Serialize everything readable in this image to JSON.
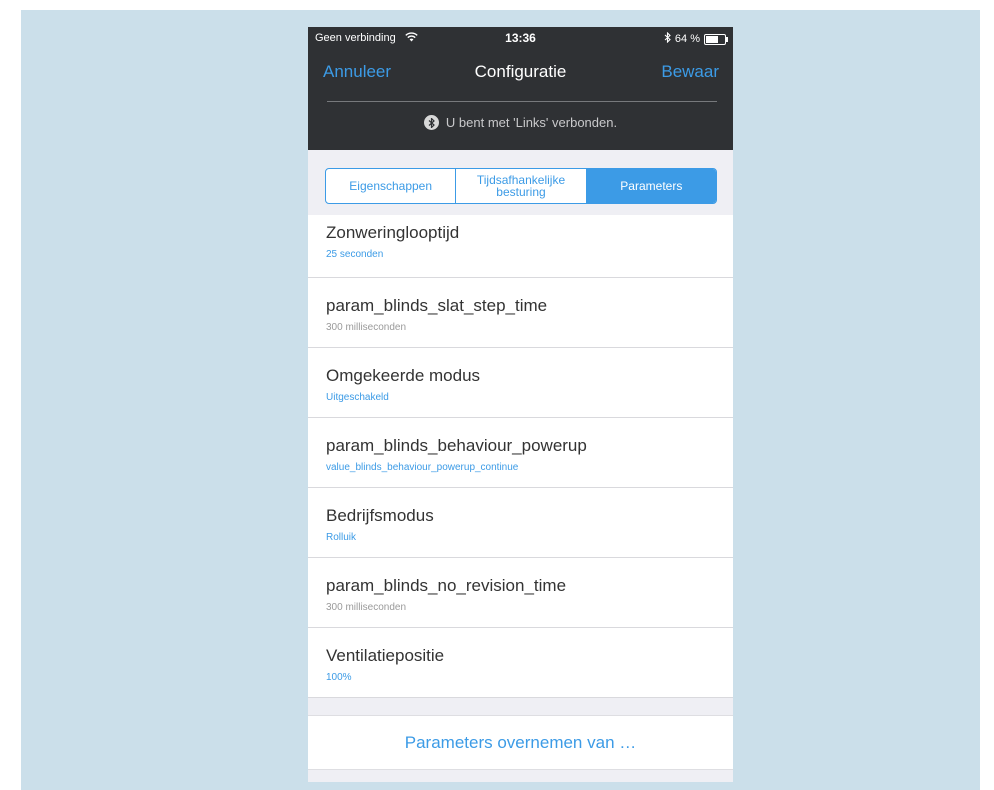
{
  "status_bar": {
    "carrier": "Geen verbinding",
    "time": "13:36",
    "battery": "64 %",
    "battery_level": 0.64
  },
  "navbar": {
    "cancel_label": "Annuleer",
    "title": "Configuratie",
    "save_label": "Bewaar"
  },
  "connection_message": "U bent met 'Links' verbonden.",
  "tabs": [
    {
      "label": "Eigenschappen",
      "active": false
    },
    {
      "label": "Tijdsafhankelijke besturing",
      "active": false
    },
    {
      "label": "Parameters",
      "active": true
    }
  ],
  "parameters": [
    {
      "title": "Zonweringlooptijd",
      "value": "25 seconden",
      "value_color": "#3c9be6"
    },
    {
      "title": "param_blinds_slat_step_time",
      "value": "300 milliseconden",
      "value_color": "#9a9a9a"
    },
    {
      "title": "Omgekeerde modus",
      "value": "Uitgeschakeld",
      "value_color": "#3c9be6"
    },
    {
      "title": "param_blinds_behaviour_powerup",
      "value": "value_blinds_behaviour_powerup_continue",
      "value_color": "#3c9be6"
    },
    {
      "title": "Bedrijfsmodus",
      "value": "Rolluik",
      "value_color": "#3c9be6"
    },
    {
      "title": "param_blinds_no_revision_time",
      "value": "300 milliseconden",
      "value_color": "#9a9a9a"
    },
    {
      "title": "Ventilatiepositie",
      "value": "100%",
      "value_color": "#3c9be6"
    }
  ],
  "copy_parameters_label": "Parameters overnemen van …",
  "colors": {
    "accent": "#3c9be6",
    "header_background": "#2f3134",
    "page_background": "#cbdfea"
  },
  "icons": {
    "wifi": "wifi-icon",
    "bluetooth": "bluetooth-icon",
    "battery": "battery-icon"
  }
}
